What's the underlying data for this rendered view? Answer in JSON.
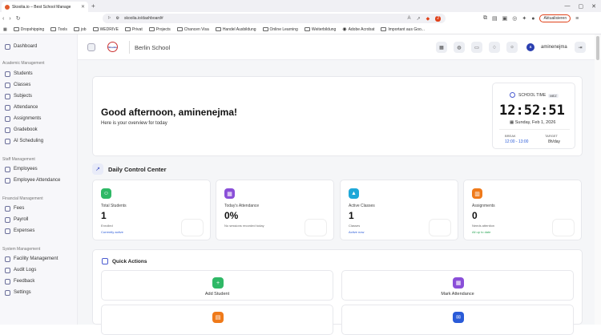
{
  "browser": {
    "tab_title": "Skoolia.io – Best School Manage",
    "url": "skoolia.io/dashboard#",
    "update_label": "Aktualisieren",
    "notif_count": "2",
    "bookmarks": [
      "Dropshipping",
      "Tools",
      "job",
      "WEDRIVE",
      "Privat",
      "Projects",
      "Chancen Visa",
      "Handel Ausbildung",
      "Online Learning",
      "Weiterbildung",
      "Adobe Acrobat",
      "Important aus Goo..."
    ]
  },
  "sidebar": {
    "dashboard": "Dashboard",
    "sections": [
      {
        "title": "Academic Management",
        "items": [
          "Students",
          "Classes",
          "Subjects",
          "Attendance",
          "Assignments",
          "Gradebook",
          "AI Scheduling"
        ]
      },
      {
        "title": "Staff Management",
        "items": [
          "Employees",
          "Employee Attendance"
        ]
      },
      {
        "title": "Financial Management",
        "items": [
          "Fees",
          "Payroll",
          "Expenses"
        ]
      },
      {
        "title": "System Management",
        "items": [
          "Facility Management",
          "Audit Logs",
          "Feedback",
          "Settings"
        ]
      }
    ]
  },
  "topbar": {
    "school_name": "Berlin School",
    "logo_text": "Skoolia",
    "avatar_letter": "a",
    "username": "aminenejma"
  },
  "greeting": {
    "title": "Good afternoon, aminenejma!",
    "subtitle": "Here is your overview for today"
  },
  "clock": {
    "label": "SCHOOL TIME",
    "tz": "MEZ",
    "time": "12:52:51",
    "date": "Sunday, Feb 1, 2026",
    "break_label": "BREAK",
    "break_value": "12:00 - 13:00",
    "target_label": "TARGET",
    "target_value": "8h/day"
  },
  "control_center": {
    "title": "Daily Control Center"
  },
  "stats": [
    {
      "label": "Total Students",
      "value": "1",
      "sub": "Enrolled",
      "link": "Currently active",
      "color": "#2fb866",
      "link_color": "#2a5bd8"
    },
    {
      "label": "Today's Attendance",
      "value": "0%",
      "sub": "No sessions recorded today",
      "link": "",
      "color": "#8a4fd8",
      "link_color": "#2a5bd8"
    },
    {
      "label": "Active Classes",
      "value": "1",
      "sub": "Classes",
      "link": "Active now",
      "color": "#1fa8d8",
      "link_color": "#2a5bd8"
    },
    {
      "label": "Assignments",
      "value": "0",
      "sub": "Needs attention",
      "link": "All up to date",
      "color": "#ef7a1a",
      "link_color": "#2fa85a"
    }
  ],
  "quick_actions": {
    "title": "Quick Actions",
    "items": [
      {
        "label": "Add Student",
        "color": "#2fb866"
      },
      {
        "label": "Mark Attendance",
        "color": "#8a4fd8"
      },
      {
        "label": "",
        "color": "#ef7a1a"
      },
      {
        "label": "",
        "color": "#2a5bd8"
      }
    ]
  }
}
